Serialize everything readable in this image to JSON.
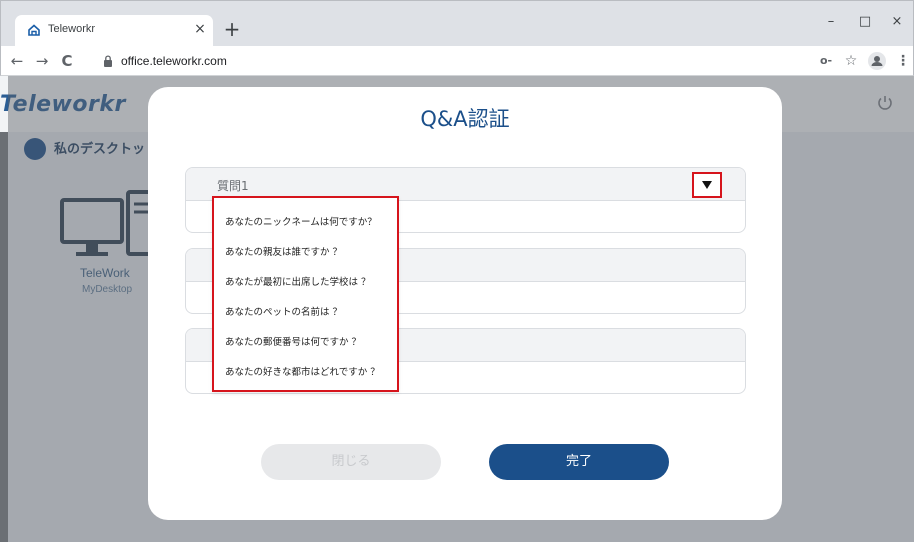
{
  "browser": {
    "tab_title": "Teleworkr",
    "tab_close": "×",
    "new_tab": "+",
    "url": "office.teleworkr.com",
    "window_buttons": [
      "–",
      "□",
      "×"
    ],
    "nav": {
      "back": "←",
      "forward": "→",
      "reload": "C"
    },
    "toolbar_icons": {
      "key": "o-",
      "star": "☆",
      "menu": "⋮"
    }
  },
  "background": {
    "logo": "Teleworkr",
    "desktop_label": "私のデスクトッ",
    "computer_name": "TeleWork",
    "computer_sub": "MyDesktop"
  },
  "modal": {
    "title": "Q&A認証",
    "question1_label": "質問1",
    "dropdown_options": [
      "あなたのニックネームは何ですか？",
      "あなたの親友は誰ですか ？",
      "あなたが最初に出席した学校は ？",
      "あなたのペットの名前は ？",
      "あなたの郵便番号は何ですか ？",
      "あなたの好きな都市はどれですか ？"
    ],
    "close_button": "閉じる",
    "done_button": "完了"
  },
  "colors": {
    "brand": "#1b4f8a",
    "highlight": "#d6141c",
    "overlay": "#5c6066"
  }
}
